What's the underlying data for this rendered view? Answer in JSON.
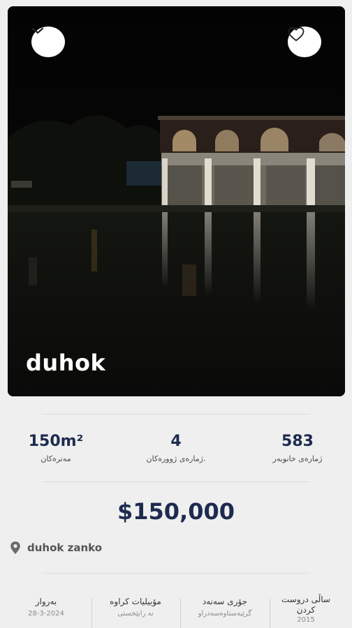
{
  "hero": {
    "title": "duhok",
    "collapse_icon": "chevron-down-icon",
    "favorite_icon": "heart-icon"
  },
  "stats": [
    {
      "value": "150m²",
      "label": "مەترەکان"
    },
    {
      "value": "4",
      "label": "ژمارەی ژوورەکان."
    },
    {
      "value": "583",
      "label": "ژمارەی خانوبەر"
    }
  ],
  "price": "$150,000",
  "location": {
    "icon": "map-pin-icon",
    "text": "duhok zanko"
  },
  "details": [
    {
      "title": "بەروار",
      "value": "28-3-2024"
    },
    {
      "title": "مۆبیلیات کراوە",
      "value": "نە رابێخستی"
    },
    {
      "title": "جۆری سەنەد",
      "value": "گرێبەستاوەسەدراو"
    },
    {
      "title": "ساڵی دروست کردن",
      "value": "2015"
    }
  ],
  "colors": {
    "accent": "#1d2b4f",
    "background": "#efefef"
  }
}
